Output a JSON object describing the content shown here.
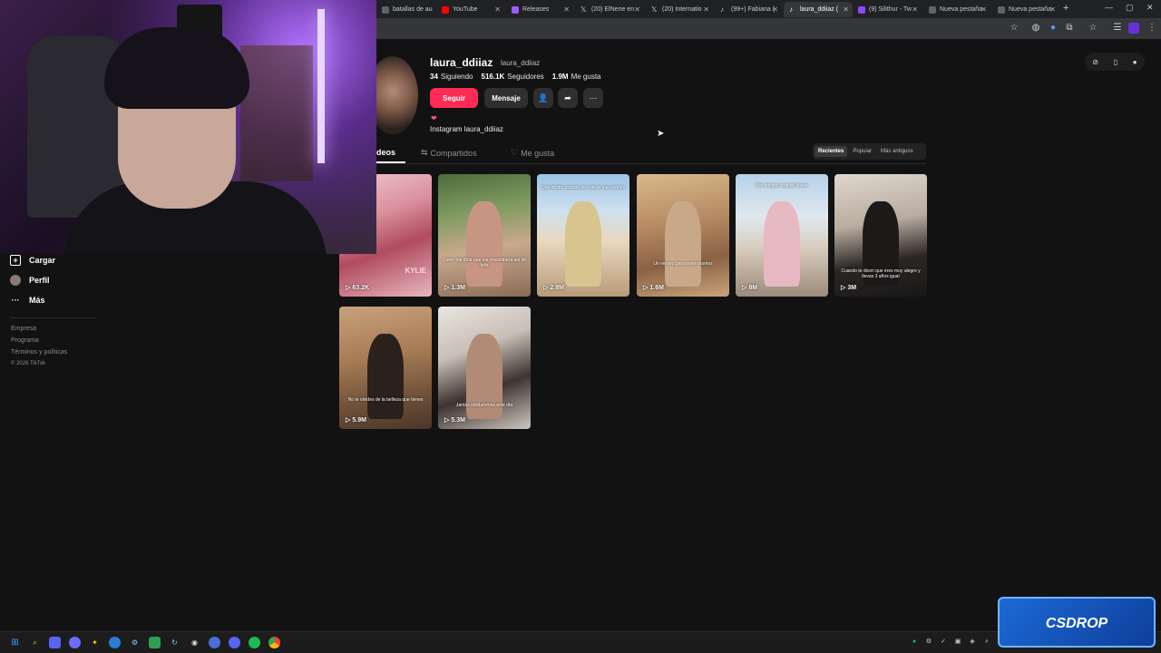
{
  "browser": {
    "tabs": [
      {
        "title": "batallas de au",
        "color": "#5f6368"
      },
      {
        "title": "YouTube",
        "color": "#ff0000"
      },
      {
        "title": "Releases",
        "color": "#a259ff"
      },
      {
        "title": "(20) ElNene en",
        "color": "#000000"
      },
      {
        "title": "(20) Internatio",
        "color": "#000000"
      },
      {
        "title": "(99+) Fabiana (",
        "color": "#000000"
      },
      {
        "title": "laura_ddiiaz (",
        "color": "#000000"
      },
      {
        "title": "(9) Silithur - Tw",
        "color": "#9146ff"
      },
      {
        "title": "Nueva pestaña",
        "color": "#5f6368"
      },
      {
        "title": "Nueva pestaña",
        "color": "#5f6368"
      }
    ],
    "active_tab_index": 6,
    "new_tab": "+",
    "window_controls": [
      "—",
      "▢",
      "✕"
    ]
  },
  "sidebar": {
    "items": [
      {
        "label": "Cargar",
        "icon": "upload-icon",
        "glyph": "+"
      },
      {
        "label": "Perfil",
        "icon": "avatar"
      },
      {
        "label": "Más",
        "icon": "more-icon",
        "glyph": "···"
      }
    ],
    "links": [
      "Empresa",
      "Programa",
      "Términos y políticas"
    ],
    "copyright": "© 2026 TikTok"
  },
  "profile": {
    "username": "laura_ddiiaz",
    "handle": "laura_ddiiaz",
    "following_count": "34",
    "following_label": "Siguiendo",
    "followers_count": "516.1K",
    "followers_label": "Seguidores",
    "likes_count": "1.9M",
    "likes_label": "Me gusta",
    "follow_button": "Seguir",
    "message_button": "Mensaje",
    "heart": "❤",
    "bio": "Instagram laura_ddiiaz"
  },
  "tabs": {
    "videos": "deos",
    "shared": "Compartidos",
    "liked": "Me gusta"
  },
  "sort": {
    "options": [
      "Recientes",
      "Popular",
      "Más antiguos"
    ],
    "selected": "Recientes"
  },
  "videos": [
    {
      "views": "63.2K",
      "caption": "",
      "overlay": "KYLIE"
    },
    {
      "views": "1.3M",
      "caption": "Quién me diría que me encontraría así de feliz"
    },
    {
      "views": "2.8M",
      "caption": "Qué bonito cuando se nota lo que sientes"
    },
    {
      "views": "1.6M",
      "caption": "Un verano para enamorarnos"
    },
    {
      "views": "8M",
      "caption": "Mis amigas cuando llueve"
    },
    {
      "views": "3M",
      "caption": "Cuando te dicen que eres muy alegre y llevas 3 años igual"
    },
    {
      "views": "5.9M",
      "caption": "No te olvides de la belleza que tienes"
    },
    {
      "views": "5.3M",
      "caption": "Jamás olvidaremos este día"
    }
  ],
  "watermark": {
    "text": "CSDROP",
    "colors": [
      "#1d6ad6",
      "#0e3e9a"
    ]
  }
}
